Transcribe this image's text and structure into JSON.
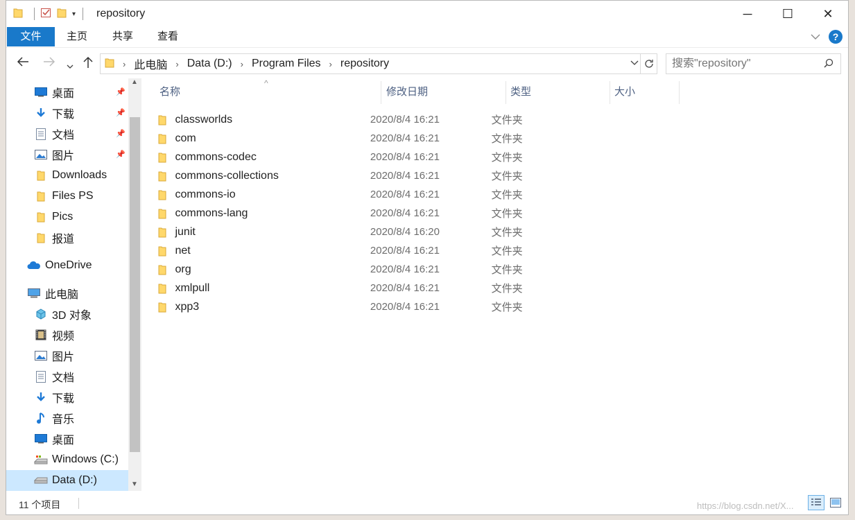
{
  "window": {
    "title": "repository",
    "controls": {
      "minimize": "─",
      "maximize": "☐",
      "close": "✕"
    }
  },
  "ribbon": {
    "tabs": [
      "文件",
      "主页",
      "共享",
      "查看"
    ]
  },
  "address": {
    "crumbs": [
      "此电脑",
      "Data (D:)",
      "Program Files",
      "repository"
    ]
  },
  "search": {
    "placeholder": "搜索\"repository\""
  },
  "nav": {
    "items": [
      {
        "label": "桌面",
        "icon": "desktop-icon",
        "pinned": true
      },
      {
        "label": "下载",
        "icon": "download-icon",
        "pinned": true
      },
      {
        "label": "文档",
        "icon": "document-icon",
        "pinned": true
      },
      {
        "label": "图片",
        "icon": "picture-icon",
        "pinned": true
      },
      {
        "label": "Downloads",
        "icon": "folder-icon",
        "pinned": false
      },
      {
        "label": "Files PS",
        "icon": "folder-icon",
        "pinned": false
      },
      {
        "label": "Pics",
        "icon": "folder-icon",
        "pinned": false
      },
      {
        "label": "报道",
        "icon": "folder-icon",
        "pinned": false
      },
      {
        "label": "OneDrive",
        "icon": "cloud-icon",
        "pinned": false
      },
      {
        "label": "此电脑",
        "icon": "computer-icon",
        "pinned": false
      },
      {
        "label": "3D 对象",
        "icon": "cube-icon",
        "pinned": false
      },
      {
        "label": "视频",
        "icon": "video-icon",
        "pinned": false
      },
      {
        "label": "图片",
        "icon": "picture-icon",
        "pinned": false
      },
      {
        "label": "文档",
        "icon": "document-icon",
        "pinned": false
      },
      {
        "label": "下载",
        "icon": "download-icon",
        "pinned": false
      },
      {
        "label": "音乐",
        "icon": "music-icon",
        "pinned": false
      },
      {
        "label": "桌面",
        "icon": "desktop-icon",
        "pinned": false
      },
      {
        "label": "Windows (C:)",
        "icon": "drive-icon",
        "pinned": false
      },
      {
        "label": "Data (D:)",
        "icon": "drive-icon",
        "pinned": false,
        "selected": true
      }
    ]
  },
  "columns": {
    "name": "名称",
    "date": "修改日期",
    "type": "类型",
    "size": "大小"
  },
  "files": [
    {
      "name": "classworlds",
      "date": "2020/8/4 16:21",
      "type": "文件夹"
    },
    {
      "name": "com",
      "date": "2020/8/4 16:21",
      "type": "文件夹"
    },
    {
      "name": "commons-codec",
      "date": "2020/8/4 16:21",
      "type": "文件夹"
    },
    {
      "name": "commons-collections",
      "date": "2020/8/4 16:21",
      "type": "文件夹"
    },
    {
      "name": "commons-io",
      "date": "2020/8/4 16:21",
      "type": "文件夹"
    },
    {
      "name": "commons-lang",
      "date": "2020/8/4 16:21",
      "type": "文件夹"
    },
    {
      "name": "junit",
      "date": "2020/8/4 16:20",
      "type": "文件夹"
    },
    {
      "name": "net",
      "date": "2020/8/4 16:21",
      "type": "文件夹"
    },
    {
      "name": "org",
      "date": "2020/8/4 16:21",
      "type": "文件夹"
    },
    {
      "name": "xmlpull",
      "date": "2020/8/4 16:21",
      "type": "文件夹"
    },
    {
      "name": "xpp3",
      "date": "2020/8/4 16:21",
      "type": "文件夹"
    }
  ],
  "status": {
    "count": "11 个项目",
    "watermark": "https://blog.csdn.net/X..."
  },
  "colors": {
    "accent": "#1979ca",
    "folder": "#ffd86b",
    "selection": "#cce8ff"
  }
}
